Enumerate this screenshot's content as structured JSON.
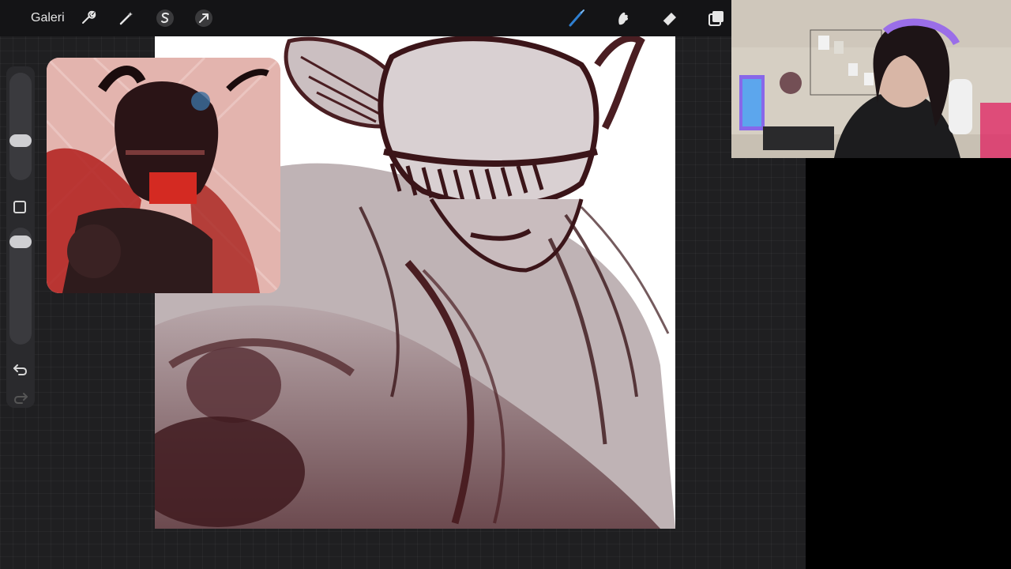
{
  "toolbar": {
    "gallery_label": "Galeri",
    "left_tools": [
      "wrench-icon",
      "magic-wand-icon",
      "selection-s-icon",
      "transform-arrow-icon"
    ],
    "right_tools": [
      "brush-icon",
      "smudge-icon",
      "eraser-icon",
      "layers-icon"
    ],
    "active_tool": "brush-icon",
    "active_color": "#2f7fd0"
  },
  "sidebar": {
    "brush_size_slider": "size",
    "opacity_slider": "opacity",
    "modify_button": "square-icon",
    "undo": "undo-icon",
    "redo": "redo-icon"
  },
  "canvas": {
    "subject": "sketch-of-armored-knight",
    "ink_color": "#4a1e22"
  },
  "reference": {
    "subject": "armored-knight-photo",
    "accent_color": "#c0201c"
  },
  "webcam": {
    "subject": "streamer-with-headphones"
  }
}
